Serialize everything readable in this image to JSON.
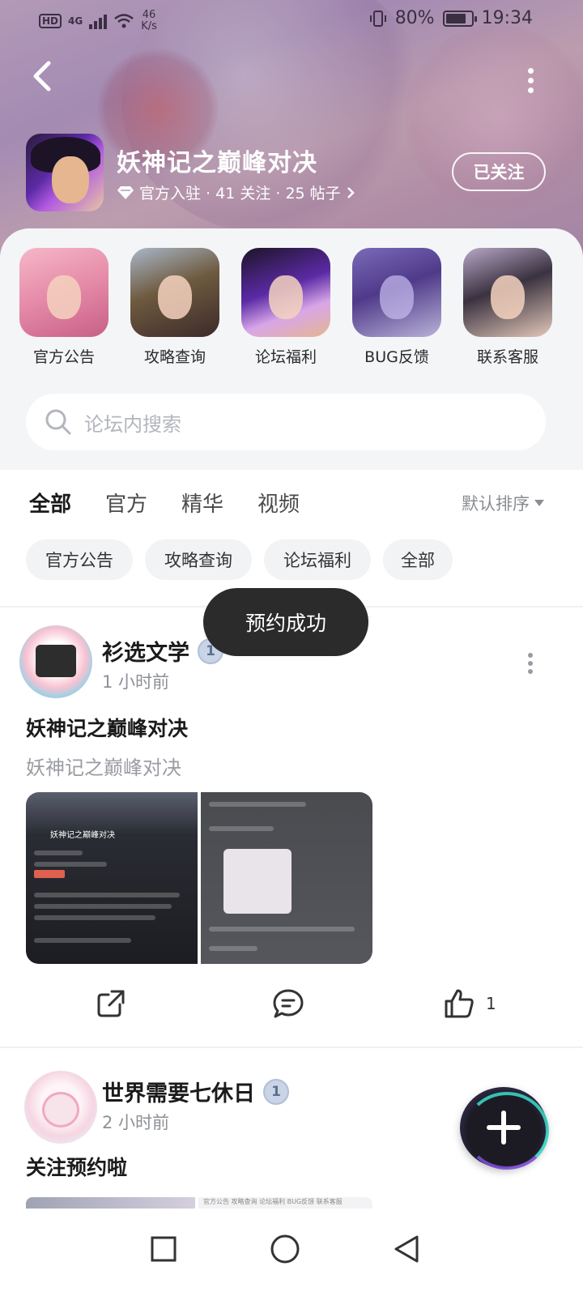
{
  "status_bar": {
    "network": "HD",
    "signal": "4G",
    "speed_value": "46",
    "speed_unit": "K/s",
    "battery": "80%",
    "battery_level": 0.8,
    "time": "19:34"
  },
  "header": {
    "game_title": "妖神记之巅峰对决",
    "meta": "官方入驻 · 41 关注 · 25 帖子",
    "follow_label": "已关注"
  },
  "quick_links": [
    {
      "label": "官方公告"
    },
    {
      "label": "攻略查询"
    },
    {
      "label": "论坛福利"
    },
    {
      "label": "BUG反馈"
    },
    {
      "label": "联系客服"
    }
  ],
  "search": {
    "placeholder": "论坛内搜索"
  },
  "tabs": {
    "items": [
      {
        "label": "全部"
      },
      {
        "label": "官方"
      },
      {
        "label": "精华"
      },
      {
        "label": "视频"
      }
    ],
    "active": "全部",
    "sort_label": "默认排序"
  },
  "chips": [
    {
      "label": "官方公告"
    },
    {
      "label": "攻略查询"
    },
    {
      "label": "论坛福利"
    },
    {
      "label": "全部"
    }
  ],
  "toast": "预约成功",
  "posts": [
    {
      "author": "衫选文学",
      "badge": "1",
      "time": "1 小时前",
      "title": "妖神记之巅峰对决",
      "subtitle": "妖神记之巅峰对决",
      "thumb_title": "妖神记之巅峰对决",
      "like_count": "1"
    },
    {
      "author": "世界需要七休日",
      "badge": "1",
      "time": "2 小时前",
      "title": "关注预约啦"
    }
  ],
  "peek_text": "官方公告   攻略查询   论坛福利   BUG反馈   联系客服",
  "colors": {
    "accent": "#27c6b4",
    "toast_bg": "#2b2b2b",
    "fab_bg": "#1c1b24"
  },
  "icons": {
    "back": "chevron-left-icon",
    "more": "more-vertical-icon",
    "search": "search-icon",
    "share": "share-icon",
    "comment": "comment-icon",
    "like": "thumbs-up-icon",
    "add": "plus-icon"
  }
}
